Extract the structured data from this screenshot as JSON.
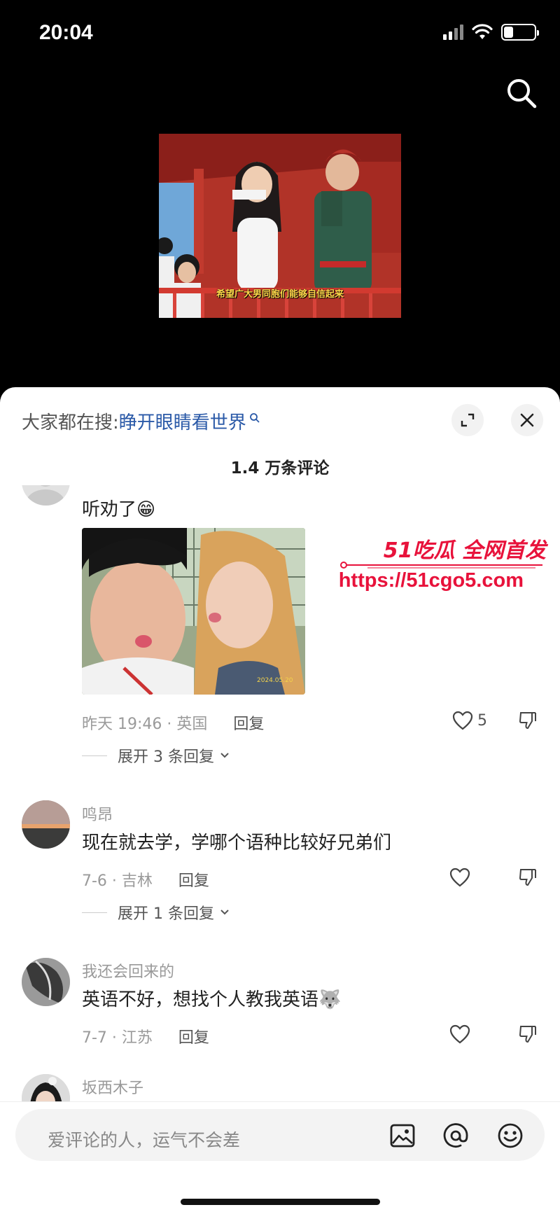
{
  "status_bar": {
    "time": "20:04",
    "battery_level": 0.3
  },
  "video": {
    "caption": "希望广大男同胞们能够自信起来"
  },
  "sheet": {
    "hot_search_prefix": "大家都在搜:",
    "hot_search_keyword": "睁开眼睛看世界",
    "comment_count": "1.4 万条评论"
  },
  "comments": [
    {
      "user": "",
      "text": "听劝了😁",
      "time_location": "昨天 19:46 · 英国",
      "reply_label": "回复",
      "likes": "5",
      "expand_label": "展开 3 条回复",
      "has_image": true
    },
    {
      "user": "鸣昂",
      "text": "现在就去学，学哪个语种比较好兄弟们",
      "time_location": "7-6 · 吉林",
      "reply_label": "回复",
      "likes": "",
      "expand_label": "展开 1 条回复"
    },
    {
      "user": "我还会回来的",
      "text": "英语不好，想找个人教我英语🐺",
      "time_location": "7-7 · 江苏",
      "reply_label": "回复",
      "likes": ""
    },
    {
      "user": "坂西木子"
    }
  ],
  "watermark": {
    "brand": "51吃瓜 全网首发",
    "url": "https://51cgo5.com"
  },
  "input": {
    "placeholder": "爱评论的人，运气不会差"
  },
  "icons": [
    "search-icon",
    "expand-icon",
    "close-icon",
    "heart-icon",
    "dislike-icon",
    "image-icon",
    "at-icon",
    "emoji-icon",
    "chevron-down-icon"
  ]
}
